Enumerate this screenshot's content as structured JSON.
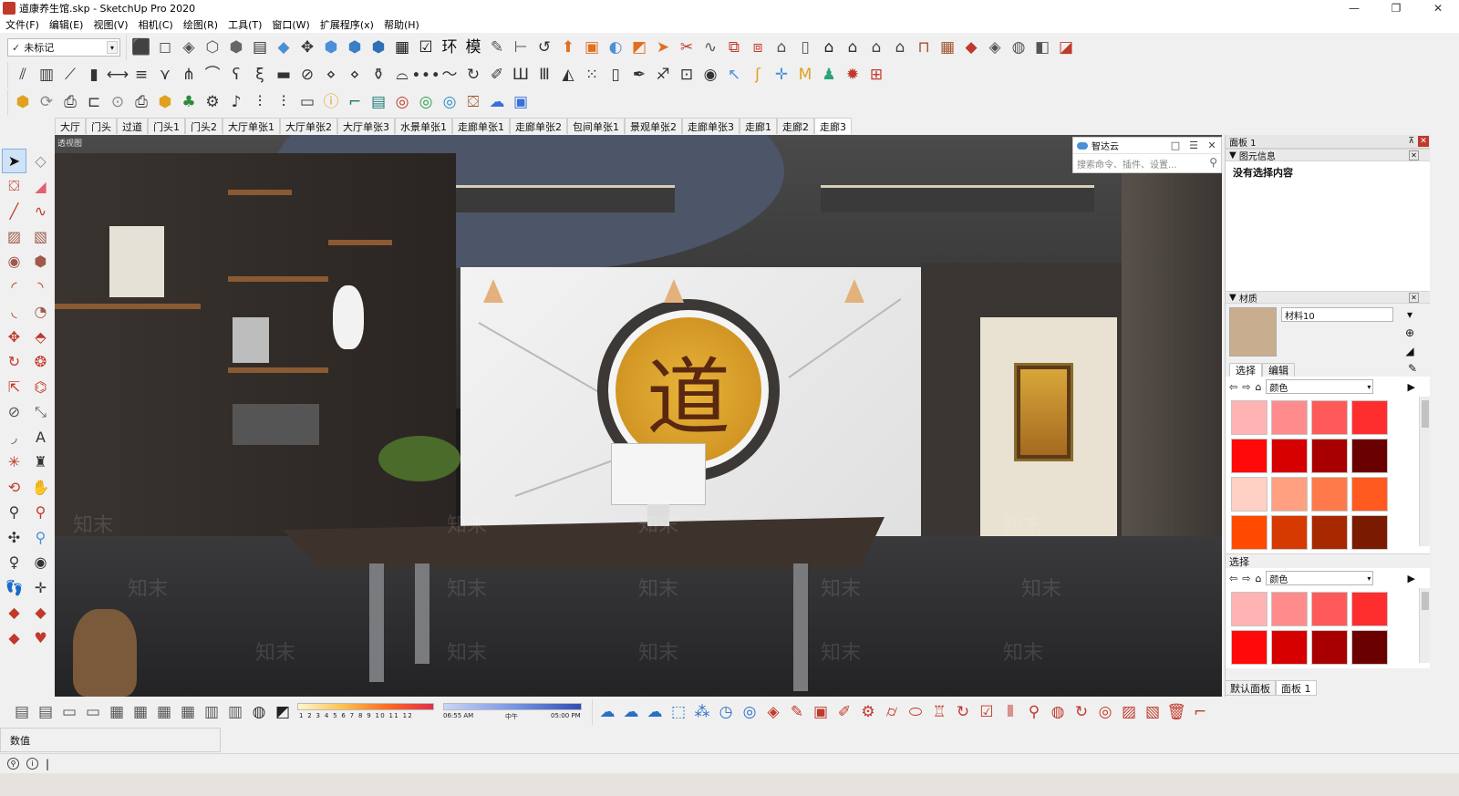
{
  "window": {
    "title": "道康养生馆.skp - SketchUp Pro 2020",
    "controls": {
      "minimize": "—",
      "maximize": "❐",
      "close": "✕"
    }
  },
  "menubar": [
    "文件(F)",
    "编辑(E)",
    "视图(V)",
    "相机(C)",
    "绘图(R)",
    "工具(T)",
    "窗口(W)",
    "扩展程序(x)",
    "帮助(H)"
  ],
  "toolbar": {
    "tag_select": {
      "check": "✓",
      "value": "未标记",
      "arrow": "▾"
    },
    "row1_icons": [
      {
        "name": "cube-icon",
        "glyph": "⬛",
        "color": "#5b7fbf"
      },
      {
        "name": "cube-outline-icon",
        "glyph": "◻",
        "color": "#555"
      },
      {
        "name": "xray-icon",
        "glyph": "◈",
        "color": "#555"
      },
      {
        "name": "wireframe-icon",
        "glyph": "⬡",
        "color": "#555"
      },
      {
        "name": "hidden-line-icon",
        "glyph": "⬢",
        "color": "#666"
      },
      {
        "name": "shaded-icon",
        "glyph": "▤",
        "color": "#333"
      },
      {
        "name": "shaded-texture-icon",
        "glyph": "◆",
        "color": "#4a90d9"
      },
      {
        "name": "orbit-icon",
        "glyph": "✥",
        "color": "#333"
      },
      {
        "name": "iso-view-icon",
        "glyph": "⬢",
        "color": "#4a90d9"
      },
      {
        "name": "top-view-icon",
        "glyph": "⬢",
        "color": "#3b7fc4"
      },
      {
        "name": "front-view-icon",
        "glyph": "⬢",
        "color": "#2f6fb5"
      },
      {
        "name": "outliner-icon",
        "glyph": "▦",
        "color": "#111"
      },
      {
        "name": "check-icon",
        "glyph": "☑",
        "color": "#111"
      },
      {
        "name": "hanzi-huan-icon",
        "glyph": "环",
        "color": "#111"
      },
      {
        "name": "hanzi-mo-icon",
        "glyph": "模",
        "color": "#111"
      },
      {
        "name": "pen-icon",
        "glyph": "✎",
        "color": "#555"
      },
      {
        "name": "dimension-icon",
        "glyph": "⊢",
        "color": "#555"
      },
      {
        "name": "tape-icon",
        "glyph": "↺",
        "color": "#333"
      },
      {
        "name": "push-pull-icon",
        "glyph": "⬆",
        "color": "#e07020"
      },
      {
        "name": "box-icon",
        "glyph": "▣",
        "color": "#e07020"
      },
      {
        "name": "follow-me-icon",
        "glyph": "◐",
        "color": "#4a90d9"
      },
      {
        "name": "offset-icon",
        "glyph": "◩",
        "color": "#e07020"
      },
      {
        "name": "arrow-tool-icon",
        "glyph": "➤",
        "color": "#e07020"
      },
      {
        "name": "scissors-icon",
        "glyph": "✂",
        "color": "#c0392b"
      },
      {
        "name": "curve-icon",
        "glyph": "∿",
        "color": "#555"
      },
      {
        "name": "frame-icon",
        "glyph": "⧉",
        "color": "#c0392b"
      },
      {
        "name": "frame2-icon",
        "glyph": "⧈",
        "color": "#c0392b"
      },
      {
        "name": "warehouse-icon",
        "glyph": "⌂",
        "color": "#555"
      },
      {
        "name": "door-icon",
        "glyph": "▯",
        "color": "#555"
      },
      {
        "name": "home-icon",
        "glyph": "⌂",
        "color": "#222"
      },
      {
        "name": "house2-icon",
        "glyph": "⌂",
        "color": "#333"
      },
      {
        "name": "house3-icon",
        "glyph": "⌂",
        "color": "#444"
      },
      {
        "name": "roof-icon",
        "glyph": "⌂",
        "color": "#444"
      },
      {
        "name": "chair-icon",
        "glyph": "⊓",
        "color": "#a0522d"
      },
      {
        "name": "mesh-icon",
        "glyph": "▦",
        "color": "#a0522d"
      },
      {
        "name": "cube3d-icon",
        "glyph": "◆",
        "color": "#c0392b"
      },
      {
        "name": "sandbox-icon",
        "glyph": "◈",
        "color": "#555"
      },
      {
        "name": "ball-icon",
        "glyph": "◍",
        "color": "#555"
      },
      {
        "name": "terrain-icon",
        "glyph": "◧",
        "color": "#555"
      },
      {
        "name": "plane-icon",
        "glyph": "◪",
        "color": "#c0392b"
      }
    ],
    "row2_icons": [
      {
        "name": "stair-icon",
        "glyph": "⫽",
        "color": "#333"
      },
      {
        "name": "window-icon",
        "glyph": "▥",
        "color": "#333"
      },
      {
        "name": "ramp-icon",
        "glyph": "⟋",
        "color": "#333"
      },
      {
        "name": "bar-chart-icon",
        "glyph": "▮",
        "color": "#333"
      },
      {
        "name": "dimension-x-icon",
        "glyph": "⟷",
        "color": "#333"
      },
      {
        "name": "align-icon",
        "glyph": "≡",
        "color": "#333"
      },
      {
        "name": "fork-icon",
        "glyph": "⋎",
        "color": "#333"
      },
      {
        "name": "branch-icon",
        "glyph": "⋔",
        "color": "#333"
      },
      {
        "name": "arch-icon",
        "glyph": "⌒",
        "color": "#333"
      },
      {
        "name": "hook-icon",
        "glyph": "ʕ",
        "color": "#333"
      },
      {
        "name": "spring-icon",
        "glyph": "ξ",
        "color": "#333"
      },
      {
        "name": "line-bar-icon",
        "glyph": "▬",
        "color": "#333"
      },
      {
        "name": "weld-icon",
        "glyph": "⊘",
        "color": "#333"
      },
      {
        "name": "grid-3d-icon",
        "glyph": "⋄",
        "color": "#333"
      },
      {
        "name": "grid-flat-icon",
        "glyph": "⋄",
        "color": "#333"
      },
      {
        "name": "bottle-icon",
        "glyph": "⚱",
        "color": "#333"
      },
      {
        "name": "hat-icon",
        "glyph": "⌓",
        "color": "#333"
      },
      {
        "name": "dots-line-icon",
        "glyph": "∙∙∙",
        "color": "#333"
      },
      {
        "name": "wave-icon",
        "glyph": "〜",
        "color": "#333"
      },
      {
        "name": "rotate-icon",
        "glyph": "↻",
        "color": "#333"
      },
      {
        "name": "draw-icon",
        "glyph": "✐",
        "color": "#333"
      },
      {
        "name": "comb-icon",
        "glyph": "Ш",
        "color": "#333"
      },
      {
        "name": "columns-icon",
        "glyph": "Ⅲ",
        "color": "#333"
      },
      {
        "name": "triangle-icon",
        "glyph": "◭",
        "color": "#333"
      },
      {
        "name": "dot-grid-icon",
        "glyph": "⁙",
        "color": "#333"
      },
      {
        "name": "tile-icon",
        "glyph": "▯",
        "color": "#333"
      },
      {
        "name": "nib-icon",
        "glyph": "✒",
        "color": "#333"
      },
      {
        "name": "brush-icon",
        "glyph": "♐",
        "color": "#333"
      },
      {
        "name": "lamp-icon",
        "glyph": "⊡",
        "color": "#333"
      },
      {
        "name": "hemisphere-icon",
        "glyph": "◉",
        "color": "#333"
      },
      {
        "name": "select-arrow-icon",
        "glyph": "↖",
        "color": "#4a90d9"
      },
      {
        "name": "bend-icon",
        "glyph": "ʃ",
        "color": "#e0a020"
      },
      {
        "name": "move-cross-icon",
        "glyph": "✛",
        "color": "#4a90d9"
      },
      {
        "name": "ma-icon",
        "glyph": "M",
        "color": "#e0a020"
      },
      {
        "name": "person-icon",
        "glyph": "♟",
        "color": "#2aa37a"
      },
      {
        "name": "gear-red-icon",
        "glyph": "✹",
        "color": "#c0392b"
      },
      {
        "name": "window-grid-icon",
        "glyph": "⊞",
        "color": "#c0392b"
      }
    ],
    "row3_icons": [
      {
        "name": "box-plus-icon",
        "glyph": "⬢",
        "color": "#e0a020"
      },
      {
        "name": "refresh-icon",
        "glyph": "⟳",
        "color": "#888"
      },
      {
        "name": "printer-icon",
        "glyph": "⎙",
        "color": "#333"
      },
      {
        "name": "projector-icon",
        "glyph": "⊏",
        "color": "#333"
      },
      {
        "name": "camera-icon",
        "glyph": "⊙",
        "color": "#888"
      },
      {
        "name": "print2-icon",
        "glyph": "⎙",
        "color": "#333"
      },
      {
        "name": "component-plus-icon",
        "glyph": "⬢",
        "color": "#e0a020"
      },
      {
        "name": "tree-icon",
        "glyph": "♣",
        "color": "#2a8a3a"
      },
      {
        "name": "settings-icon",
        "glyph": "⚙",
        "color": "#333"
      },
      {
        "name": "speaker-icon",
        "glyph": "♪",
        "color": "#333"
      },
      {
        "name": "sliders-icon",
        "glyph": "⫶",
        "color": "#333"
      },
      {
        "name": "sliders2-icon",
        "glyph": "⫶",
        "color": "#333"
      },
      {
        "name": "chat-icon",
        "glyph": "▭",
        "color": "#333"
      },
      {
        "name": "info-icon",
        "glyph": "ⓘ",
        "color": "#e0a020"
      },
      {
        "name": "stair-green-icon",
        "glyph": "⌐",
        "color": "#1a7a5a"
      },
      {
        "name": "ens-icon",
        "glyph": "▤",
        "color": "#1a7a7a"
      },
      {
        "name": "swirl-red-icon",
        "glyph": "◎",
        "color": "#c0392b"
      },
      {
        "name": "swirl-green-icon",
        "glyph": "◎",
        "color": "#2aa34a"
      },
      {
        "name": "swirl-blue-icon",
        "glyph": "◎",
        "color": "#2a8ac4"
      },
      {
        "name": "paint-bucket-icon",
        "glyph": "⛋",
        "color": "#a0522d"
      },
      {
        "name": "cloud-icon",
        "glyph": "☁",
        "color": "#3a6fd9"
      },
      {
        "name": "device-icon",
        "glyph": "▣",
        "color": "#3a6fd9"
      }
    ]
  },
  "scene_tabs": [
    "大厅",
    "门头",
    "过道",
    "门头1",
    "门头2",
    "大厅单张1",
    "大厅单张2",
    "大厅单张3",
    "水景单张1",
    "走廊单张1",
    "走廊单张2",
    "包间单张1",
    "景观单张2",
    "走廊单张3",
    "走廊1",
    "走廊2",
    "走廊3"
  ],
  "scene_tab_active": "走廊3",
  "left_tools": [
    {
      "name": "select-arrow-icon",
      "glyph": "➤",
      "color": "#111"
    },
    {
      "name": "component-icon",
      "glyph": "◇",
      "color": "#888"
    },
    {
      "name": "paint-bucket-icon",
      "glyph": "⛋",
      "color": "#c0392b"
    },
    {
      "name": "eraser-icon",
      "glyph": "◢",
      "color": "#e06070"
    },
    {
      "name": "line-icon",
      "glyph": "╱",
      "color": "#c0392b"
    },
    {
      "name": "freehand-icon",
      "glyph": "∿",
      "color": "#c0392b"
    },
    {
      "name": "rectangle-icon",
      "glyph": "▨",
      "color": "#a05a4a"
    },
    {
      "name": "rotated-rect-icon",
      "glyph": "▧",
      "color": "#a05a4a"
    },
    {
      "name": "circle-icon",
      "glyph": "◉",
      "color": "#a05a4a"
    },
    {
      "name": "polygon-icon",
      "glyph": "⬢",
      "color": "#a05a4a"
    },
    {
      "name": "arc-icon",
      "glyph": "◜",
      "color": "#c0392b"
    },
    {
      "name": "arc2-icon",
      "glyph": "◝",
      "color": "#c0392b"
    },
    {
      "name": "arc3-icon",
      "glyph": "◟",
      "color": "#c0392b"
    },
    {
      "name": "pie-icon",
      "glyph": "◔",
      "color": "#a05a4a"
    },
    {
      "name": "move-icon",
      "glyph": "✥",
      "color": "#c0392b"
    },
    {
      "name": "push-pull-icon",
      "glyph": "⬘",
      "color": "#c0392b"
    },
    {
      "name": "rotate-icon",
      "glyph": "↻",
      "color": "#c0392b"
    },
    {
      "name": "follow-me-icon",
      "glyph": "❂",
      "color": "#c0392b"
    },
    {
      "name": "scale-icon",
      "glyph": "⇱",
      "color": "#c0392b"
    },
    {
      "name": "offset-icon",
      "glyph": "⌬",
      "color": "#c0392b"
    },
    {
      "name": "tape-measure-icon",
      "glyph": "⊘",
      "color": "#555"
    },
    {
      "name": "dimension-icon",
      "glyph": "⤡",
      "color": "#555"
    },
    {
      "name": "protractor-icon",
      "glyph": "◞",
      "color": "#555"
    },
    {
      "name": "text-icon",
      "glyph": "A",
      "color": "#333"
    },
    {
      "name": "axes-icon",
      "glyph": "✳",
      "color": "#c0392b"
    },
    {
      "name": "3d-text-icon",
      "glyph": "♜",
      "color": "#333"
    },
    {
      "name": "orbit-icon",
      "glyph": "⟲",
      "color": "#c0392b"
    },
    {
      "name": "pan-icon",
      "glyph": "✋",
      "color": "#e0a020"
    },
    {
      "name": "zoom-icon",
      "glyph": "⚲",
      "color": "#333"
    },
    {
      "name": "zoom-window-icon",
      "glyph": "⚲",
      "color": "#c0392b"
    },
    {
      "name": "zoom-extents-icon",
      "glyph": "✣",
      "color": "#333"
    },
    {
      "name": "previous-view-icon",
      "glyph": "⚲",
      "color": "#4a90d9"
    },
    {
      "name": "position-camera-icon",
      "glyph": "♀",
      "color": "#333"
    },
    {
      "name": "look-around-icon",
      "glyph": "◉",
      "color": "#333"
    },
    {
      "name": "walk-icon",
      "glyph": "👣",
      "color": "#333"
    },
    {
      "name": "section-plane-icon",
      "glyph": "✛",
      "color": "#333"
    },
    {
      "name": "box-red-icon",
      "glyph": "◆",
      "color": "#c0392b"
    },
    {
      "name": "box-red2-icon",
      "glyph": "◆",
      "color": "#c0392b"
    },
    {
      "name": "box-red3-icon",
      "glyph": "◆",
      "color": "#c0392b"
    },
    {
      "name": "heart-icon",
      "glyph": "♥",
      "color": "#c0392b"
    }
  ],
  "viewport": {
    "label": "透视图",
    "calligraphy": "道",
    "watermark": "知末"
  },
  "cloud_panel": {
    "title": "智达云",
    "search_placeholder": "搜索命令、插件、设置...",
    "controls": {
      "restore": "□",
      "menu": "☰",
      "close": "✕"
    }
  },
  "tray": {
    "title": "面板 1",
    "pin": "⊼",
    "close": "✕",
    "entity_info": {
      "header": "图元信息",
      "body": "没有选择内容"
    },
    "materials": {
      "header": "材质",
      "swatch_color": "#c9ad8f",
      "name": "材料10",
      "tabs": [
        "选择",
        "编辑"
      ],
      "active_tab": "选择",
      "library": "颜色",
      "colors_1": [
        "#ffb3b3",
        "#ff8c8c",
        "#ff5a5a",
        "#ff2e2e",
        "#ff0a0a",
        "#d60000",
        "#a80000",
        "#6b0000",
        "#ffd0c4",
        "#ffa080",
        "#ff7a4a",
        "#ff5a20",
        "#ff4a00",
        "#d63a00",
        "#a82800",
        "#7a1a00"
      ],
      "secondary_header": "选择",
      "secondary_library": "颜色",
      "colors_2": [
        "#ffb3b3",
        "#ff8c8c",
        "#ff5a5a",
        "#ff2e2e",
        "#ff0a0a",
        "#d60000",
        "#a80000",
        "#6b0000"
      ]
    },
    "tabs": [
      "默认面板",
      "面板 1"
    ],
    "active_tab": "面板 1"
  },
  "bottom_toolbar": {
    "icons_left": [
      {
        "name": "scene-icon",
        "glyph": "▤",
        "color": "#555"
      },
      {
        "name": "scene2-icon",
        "glyph": "▤",
        "color": "#555"
      },
      {
        "name": "page-icon",
        "glyph": "▭",
        "color": "#555"
      },
      {
        "name": "page2-icon",
        "glyph": "▭",
        "color": "#555"
      },
      {
        "name": "layout-icon",
        "glyph": "▦",
        "color": "#555"
      },
      {
        "name": "layout2-icon",
        "glyph": "▦",
        "color": "#555"
      },
      {
        "name": "layout3-icon",
        "glyph": "▦",
        "color": "#555"
      },
      {
        "name": "layout4-icon",
        "glyph": "▦",
        "color": "#555"
      },
      {
        "name": "layout5-icon",
        "glyph": "▥",
        "color": "#555"
      },
      {
        "name": "layout6-icon",
        "glyph": "▥",
        "color": "#555"
      },
      {
        "name": "globe-icon",
        "glyph": "◍",
        "color": "#333"
      },
      {
        "name": "shadow-toggle-icon",
        "glyph": "◩",
        "color": "#222"
      }
    ],
    "shadow_months": "1 2 3 4 5 6 7 8 9 10 11 12",
    "time_start": "06:55 AM",
    "time_mid": "中午",
    "time_end": "05:00 PM",
    "icons_right": [
      {
        "name": "cloud-sync-icon",
        "glyph": "☁",
        "color": "#2a6fc4"
      },
      {
        "name": "cloud-sync2-icon",
        "glyph": "☁",
        "color": "#2a6fc4"
      },
      {
        "name": "cloud-sync3-icon",
        "glyph": "☁",
        "color": "#2a6fc4"
      },
      {
        "name": "select-box-icon",
        "glyph": "⬚",
        "color": "#2a6fc4"
      },
      {
        "name": "molecule-icon",
        "glyph": "⁂",
        "color": "#2a6fc4"
      },
      {
        "name": "stopwatch-icon",
        "glyph": "◷",
        "color": "#2a6fc4"
      },
      {
        "name": "shield-icon",
        "glyph": "◎",
        "color": "#2a6fc4"
      },
      {
        "name": "cube-red-icon",
        "glyph": "◈",
        "color": "#c0392b"
      },
      {
        "name": "edit-red-icon",
        "glyph": "✎",
        "color": "#c0392b"
      },
      {
        "name": "frame-red-icon",
        "glyph": "▣",
        "color": "#c0392b"
      },
      {
        "name": "pen-red-icon",
        "glyph": "✐",
        "color": "#c0392b"
      },
      {
        "name": "gear-red-icon",
        "glyph": "⚙",
        "color": "#c0392b"
      },
      {
        "name": "cylinder-red-icon",
        "glyph": "⌭",
        "color": "#c0392b"
      },
      {
        "name": "capsule-red-icon",
        "glyph": "⬭",
        "color": "#c0392b"
      },
      {
        "name": "lamp-red-icon",
        "glyph": "♖",
        "color": "#c0392b"
      },
      {
        "name": "cycle-red-icon",
        "glyph": "↻",
        "color": "#c0392b"
      },
      {
        "name": "check-red-icon",
        "glyph": "☑",
        "color": "#c0392b"
      },
      {
        "name": "columns-red-icon",
        "glyph": "⫴",
        "color": "#c0392b"
      },
      {
        "name": "search-red-icon",
        "glyph": "⚲",
        "color": "#c0392b"
      },
      {
        "name": "globe-red-icon",
        "glyph": "◍",
        "color": "#c0392b"
      },
      {
        "name": "rotate-red-icon",
        "glyph": "↻",
        "color": "#c0392b"
      },
      {
        "name": "target-red-icon",
        "glyph": "◎",
        "color": "#c0392b"
      },
      {
        "name": "image-red-icon",
        "glyph": "▨",
        "color": "#c0392b"
      },
      {
        "name": "photo-red-icon",
        "glyph": "▧",
        "color": "#c0392b"
      },
      {
        "name": "trash-red-icon",
        "glyph": "🗑",
        "color": "#c0392b"
      },
      {
        "name": "corner-red-icon",
        "glyph": "⌐",
        "color": "#c0392b"
      }
    ]
  },
  "measurements": {
    "label": "数值"
  },
  "status": {
    "geo_icon": "⚲",
    "info_icon": "i",
    "separator": "|"
  }
}
